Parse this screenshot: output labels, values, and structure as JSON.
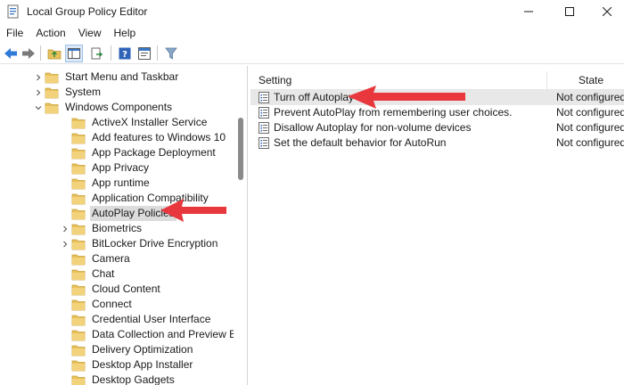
{
  "window": {
    "title": "Local Group Policy Editor",
    "controls": [
      "minimize",
      "maximize",
      "close"
    ]
  },
  "menu": [
    {
      "label": "File"
    },
    {
      "label": "Action"
    },
    {
      "label": "View"
    },
    {
      "label": "Help"
    }
  ],
  "toolbar": {
    "buttons": [
      "back-arrow-icon",
      "forward-arrow-icon",
      "up-folder-icon",
      "show-hide-tree-icon",
      "export-list-icon",
      "help-icon",
      "properties-icon",
      "filter-icon"
    ]
  },
  "tree": {
    "items": [
      {
        "label": "Start Menu and Taskbar",
        "expander": "collapsed"
      },
      {
        "label": "System",
        "expander": "collapsed"
      },
      {
        "label": "Windows Components",
        "expander": "expanded"
      },
      {
        "label": "ActiveX Installer Service",
        "expander": "none"
      },
      {
        "label": "Add features to Windows 10",
        "expander": "none"
      },
      {
        "label": "App Package Deployment",
        "expander": "none"
      },
      {
        "label": "App Privacy",
        "expander": "none"
      },
      {
        "label": "App runtime",
        "expander": "none"
      },
      {
        "label": "Application Compatibility",
        "expander": "none"
      },
      {
        "label": "AutoPlay Policies",
        "expander": "none",
        "selected": true
      },
      {
        "label": "Biometrics",
        "expander": "collapsed"
      },
      {
        "label": "BitLocker Drive Encryption",
        "expander": "collapsed"
      },
      {
        "label": "Camera",
        "expander": "none"
      },
      {
        "label": "Chat",
        "expander": "none"
      },
      {
        "label": "Cloud Content",
        "expander": "none"
      },
      {
        "label": "Connect",
        "expander": "none"
      },
      {
        "label": "Credential User Interface",
        "expander": "none"
      },
      {
        "label": "Data Collection and Preview Builds",
        "expander": "none"
      },
      {
        "label": "Delivery Optimization",
        "expander": "none"
      },
      {
        "label": "Desktop App Installer",
        "expander": "none"
      },
      {
        "label": "Desktop Gadgets",
        "expander": "none"
      }
    ]
  },
  "list": {
    "columns": {
      "setting": "Setting",
      "state": "State"
    },
    "rows": [
      {
        "name": "Turn off Autoplay",
        "state": "Not configured",
        "selected": true
      },
      {
        "name": "Prevent AutoPlay from remembering user choices.",
        "state": "Not configured"
      },
      {
        "name": "Disallow Autoplay for non-volume devices",
        "state": "Not configured"
      },
      {
        "name": "Set the default behavior for AutoRun",
        "state": "Not configured"
      }
    ]
  },
  "colors": {
    "folder": "#e8c15a",
    "folder_dark": "#c9a03c",
    "annotation_arrow": "#e8383d",
    "selection": "#dcdcdc"
  }
}
